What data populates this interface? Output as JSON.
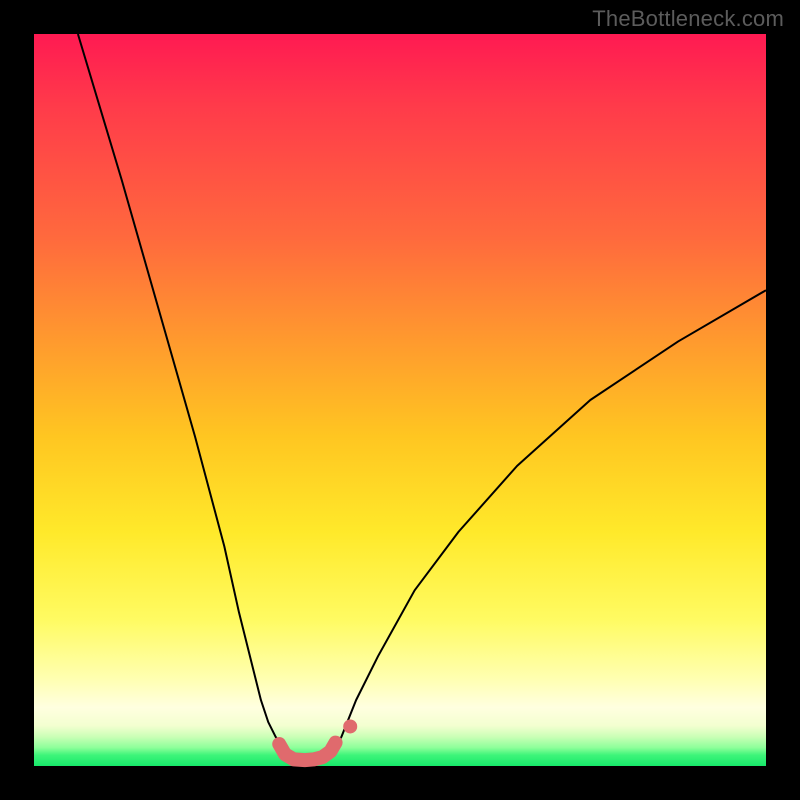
{
  "watermark": "TheBottleneck.com",
  "chart_data": {
    "type": "line",
    "title": "",
    "xlabel": "",
    "ylabel": "",
    "xlim": [
      0,
      100
    ],
    "ylim": [
      0,
      100
    ],
    "grid": false,
    "legend": false,
    "series": [
      {
        "name": "left-branch",
        "stroke": "#000000",
        "stroke_width": 2,
        "x": [
          6,
          12,
          18,
          22,
          26,
          28,
          30,
          31,
          32,
          33,
          34,
          34.8
        ],
        "values": [
          100,
          80,
          59,
          45,
          30,
          21,
          13,
          9,
          6,
          4,
          2.5,
          1.3
        ]
      },
      {
        "name": "right-branch",
        "stroke": "#000000",
        "stroke_width": 2,
        "x": [
          40.5,
          42,
          44,
          47,
          52,
          58,
          66,
          76,
          88,
          100
        ],
        "values": [
          1.3,
          4,
          9,
          15,
          24,
          32,
          41,
          50,
          58,
          65
        ]
      },
      {
        "name": "bottom-highlight",
        "stroke": "#e06a6d",
        "stroke_width": 14,
        "linecap": "round",
        "x": [
          33.5,
          34.3,
          35.5,
          37,
          38.2,
          39.4,
          40.5,
          41.2
        ],
        "values": [
          3.0,
          1.6,
          0.9,
          0.8,
          0.9,
          1.2,
          2.0,
          3.2
        ]
      },
      {
        "name": "bottom-highlight-dot",
        "stroke": "#e06a6d",
        "type_hint": "dot",
        "r": 7,
        "x": [
          43.2
        ],
        "values": [
          5.4
        ]
      }
    ]
  }
}
